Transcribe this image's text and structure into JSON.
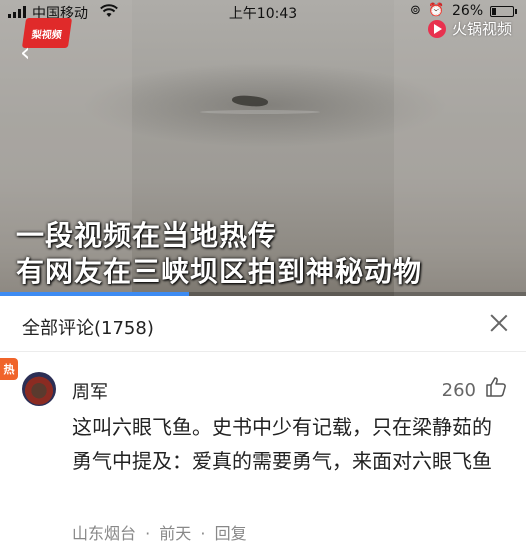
{
  "status_bar": {
    "carrier": "中国移动",
    "time": "上午10:43",
    "battery_percent": "26%",
    "battery_level": 0.26
  },
  "video": {
    "source_logo": "梨视频",
    "app_brand": "火锅视频",
    "caption_line1": "一段视频在当地热传",
    "caption_line2": "有网友在三峡坝区拍到神秘动物",
    "progress_fraction": 0.36
  },
  "comments": {
    "title": "全部评论(1758)",
    "items": [
      {
        "badge": "热",
        "username": "周军",
        "likes": "260",
        "text": "这叫六眼飞鱼。史书中少有记载，只在梁静茹的勇气中提及：爱真的需要勇气，来面对六眼飞鱼",
        "location": "山东烟台",
        "separator": "·",
        "time": "前天",
        "reply_label": "回复"
      }
    ]
  },
  "colors": {
    "accent": "#3d8bf2",
    "hot_badge": "#f0642a",
    "brand_red": "#e8324f"
  }
}
